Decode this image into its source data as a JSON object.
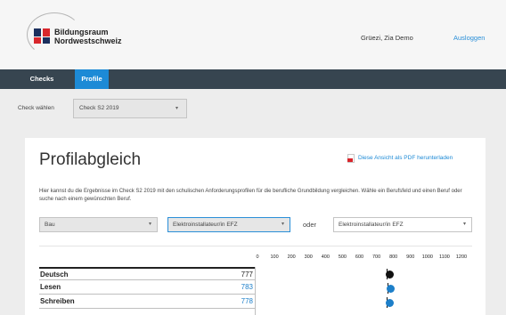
{
  "header": {
    "logo_line1": "Bildungsraum",
    "logo_line2": "Nordwestschweiz",
    "greeting": "Grüezi, Zia Demo",
    "logout_label": "Ausloggen"
  },
  "nav": {
    "tabs": [
      {
        "label": "Checks",
        "active": false
      },
      {
        "label": "Profile",
        "active": true
      }
    ],
    "accent_color": "#1d8ad6"
  },
  "check_selector": {
    "label": "Check wählen",
    "value": "Check S2 2019"
  },
  "main": {
    "title": "Profilabgleich",
    "pdf_link": "Diese Ansicht als PDF herunterladen",
    "intro": "Hier kannst du die Ergebnisse im Check S2 2019 mit den schulischen Anforderungsprofilen für die berufliche Grundbildung vergleichen. Wähle ein Berufsfeld und einen Beruf oder suche nach einem gewünschten Beruf.",
    "field_select": "Bau",
    "job_select": "Elektroinstallateur/in EFZ",
    "or_label": "oder",
    "search_select": "Elektroinstallateur/in EFZ"
  },
  "chart_data": {
    "type": "table",
    "scale": [
      0,
      100,
      200,
      300,
      400,
      500,
      600,
      700,
      800,
      900,
      1000,
      1100,
      1200
    ],
    "rows": [
      {
        "name": "Deutsch",
        "value": 777,
        "style": "bold",
        "marker_color": "#111111"
      },
      {
        "name": "Lesen",
        "value": 783,
        "style": "link",
        "marker_color": "#1d7fc9"
      },
      {
        "name": "Schreiben",
        "value": 778,
        "style": "link",
        "marker_color": "#1d7fc9"
      }
    ],
    "marker_colors": {
      "overall": "#111111",
      "sub": "#1d7fc9"
    }
  }
}
